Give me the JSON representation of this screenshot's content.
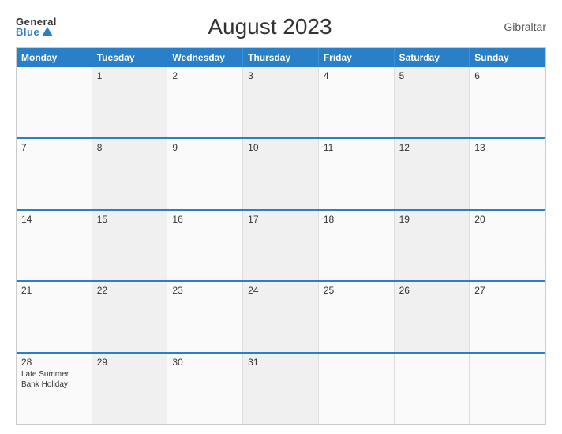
{
  "header": {
    "logo_general": "General",
    "logo_blue": "Blue",
    "title": "August 2023",
    "region": "Gibraltar"
  },
  "weekdays": [
    "Monday",
    "Tuesday",
    "Wednesday",
    "Thursday",
    "Friday",
    "Saturday",
    "Sunday"
  ],
  "weeks": [
    [
      {
        "day": "",
        "events": []
      },
      {
        "day": "1",
        "events": []
      },
      {
        "day": "2",
        "events": []
      },
      {
        "day": "3",
        "events": []
      },
      {
        "day": "4",
        "events": []
      },
      {
        "day": "5",
        "events": []
      },
      {
        "day": "6",
        "events": []
      }
    ],
    [
      {
        "day": "7",
        "events": []
      },
      {
        "day": "8",
        "events": []
      },
      {
        "day": "9",
        "events": []
      },
      {
        "day": "10",
        "events": []
      },
      {
        "day": "11",
        "events": []
      },
      {
        "day": "12",
        "events": []
      },
      {
        "day": "13",
        "events": []
      }
    ],
    [
      {
        "day": "14",
        "events": []
      },
      {
        "day": "15",
        "events": []
      },
      {
        "day": "16",
        "events": []
      },
      {
        "day": "17",
        "events": []
      },
      {
        "day": "18",
        "events": []
      },
      {
        "day": "19",
        "events": []
      },
      {
        "day": "20",
        "events": []
      }
    ],
    [
      {
        "day": "21",
        "events": []
      },
      {
        "day": "22",
        "events": []
      },
      {
        "day": "23",
        "events": []
      },
      {
        "day": "24",
        "events": []
      },
      {
        "day": "25",
        "events": []
      },
      {
        "day": "26",
        "events": []
      },
      {
        "day": "27",
        "events": []
      }
    ],
    [
      {
        "day": "28",
        "events": [
          "Late Summer Bank Holiday"
        ]
      },
      {
        "day": "29",
        "events": []
      },
      {
        "day": "30",
        "events": []
      },
      {
        "day": "31",
        "events": []
      },
      {
        "day": "",
        "events": []
      },
      {
        "day": "",
        "events": []
      },
      {
        "day": "",
        "events": []
      }
    ]
  ]
}
